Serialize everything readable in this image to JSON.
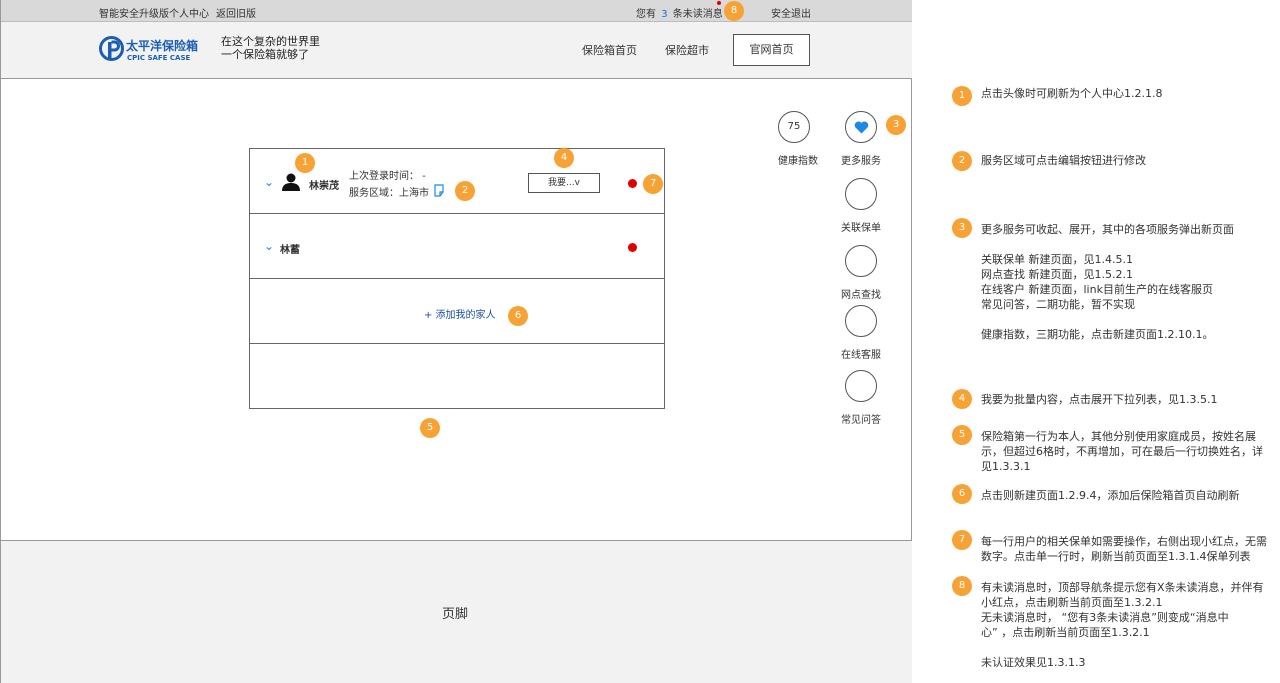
{
  "topbar": {
    "title": "智能安全升级版个人中心",
    "back_old": "返回旧版",
    "msg_prefix": "您有",
    "msg_count": "3",
    "msg_suffix": "条未读消息",
    "logout": "安全退出"
  },
  "header": {
    "brand_cn": "太平洋保险箱",
    "brand_en": "CPIC SAFE CASE",
    "slogan_line1": "在这个复杂的世界里",
    "slogan_line2": "一个保险箱就够了",
    "nav": [
      "保险箱首页",
      "保险超市",
      "官网首页"
    ]
  },
  "services": {
    "health_value": "75",
    "health_label": "健康指数",
    "more_label": "更多服务",
    "items": [
      "关联保单",
      "网点查找",
      "在线客服",
      "常见问答"
    ]
  },
  "family": {
    "row1": {
      "name": "林崇茂",
      "last_login": "上次登录时间：  -",
      "service_area": "服务区域：上海市",
      "dropdown": "我要...v"
    },
    "row2": {
      "name": "林蓄"
    },
    "add_family": "+ 添加我的家人"
  },
  "footer": {
    "label": "页脚"
  },
  "badges": [
    "1",
    "2",
    "3",
    "4",
    "5",
    "6",
    "7",
    "8"
  ],
  "notes": [
    {
      "num": "1",
      "text": "点击头像时可刷新为个人中心1.2.1.8"
    },
    {
      "num": "2",
      "text": "服务区域可点击编辑按钮进行修改"
    },
    {
      "num": "3",
      "text": "更多服务可收起、展开，其中的各项服务弹出新页面\n\n关联保单   新建页面，见1.4.5.1\n网点查找   新建页面，见1.5.2.1\n在线客户   新建页面，link目前生产的在线客服页\n常见问答，二期功能，暂不实现\n\n健康指数，三期功能，点击新建页面1.2.10.1。"
    },
    {
      "num": "4",
      "text": "我要为批量内容，点击展开下拉列表，见1.3.5.1"
    },
    {
      "num": "5",
      "text": "保险箱第一行为本人，其他分别使用家庭成员，按姓名展\n示，但超过6格时，不再增加，可在最后一行切换姓名，详\n见1.3.3.1"
    },
    {
      "num": "6",
      "text": "点击则新建页面1.2.9.4，添加后保险箱首页自动刷新"
    },
    {
      "num": "7",
      "text": "每一行用户的相关保单如需要操作，右侧出现小红点，无需\n数字。点击单一行时，刷新当前页面至1.3.1.4保单列表"
    },
    {
      "num": "8",
      "text": "有未读消息时，顶部导航条提示您有X条未读消息，并伴有\n小红点，点击刷新当前页面至1.3.2.1\n无未读消息时，  “您有3条未读消息”则变成“消息中\n心”  ，点击刷新当前页面至1.3.2.1\n\n未认证效果见1.3.1.3"
    }
  ]
}
